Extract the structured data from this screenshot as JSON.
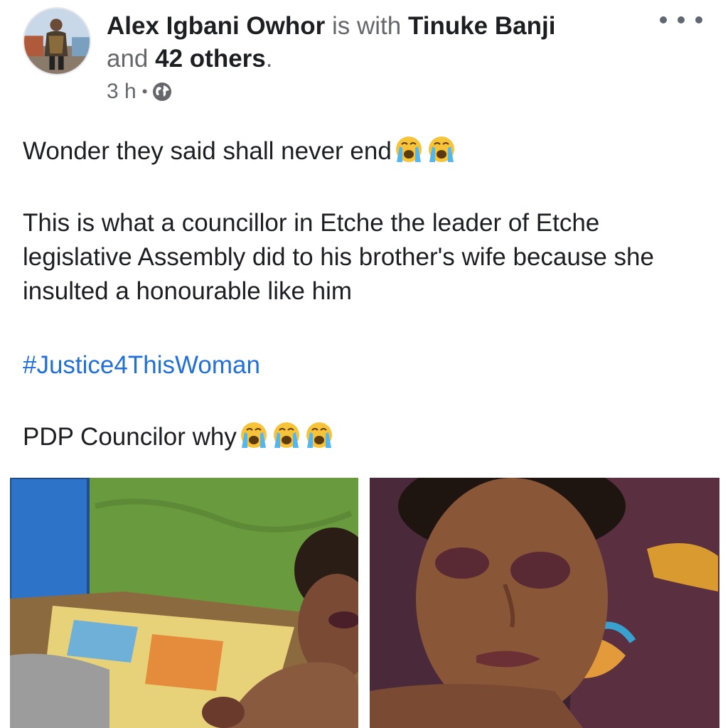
{
  "post": {
    "author": "Alex Igbani Owhor",
    "with_text": "is with",
    "tagged_person": "Tinuke Banji",
    "and_text": "and",
    "others_count": "42 others",
    "period": ".",
    "time": "3 h",
    "separator": "•",
    "privacy_icon": "globe-icon",
    "more_icon": "more-options-icon",
    "paragraphs": {
      "p1": "Wonder they said shall never end",
      "p2": "This is what a councillor in Etche the leader of Etche legislative Assembly did to his brother's wife because she insulted a honourable like him",
      "hashtag": "#Justice4ThisWoman",
      "p3": "PDP Councilor why"
    },
    "emoji": "crying-face-emoji",
    "photos": [
      "photo-1",
      "photo-2"
    ]
  },
  "colors": {
    "text": "#1c1e21",
    "secondary": "#65676b",
    "hashtag": "#216fdb"
  }
}
